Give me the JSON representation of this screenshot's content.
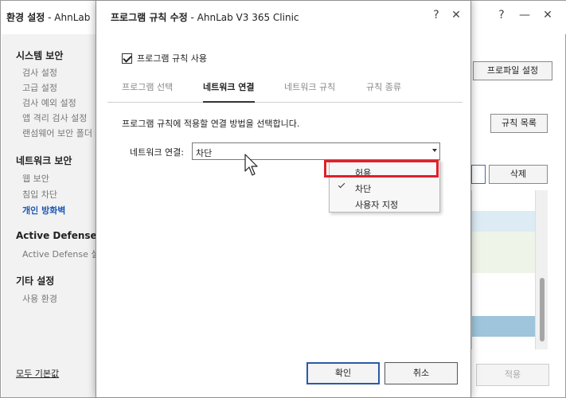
{
  "background": {
    "title_bold": "환경 설정",
    "title_light": " - AhnLab",
    "controls": {
      "help": "?",
      "minimize": "—",
      "close": "✕"
    },
    "sidebar": {
      "sections": [
        {
          "heading": "시스템 보안",
          "items": [
            "검사 설정",
            "고급 설정",
            "검사 예외 설정",
            "앱 격리 검사 설정",
            "랜섬웨어 보안 폴더"
          ]
        },
        {
          "heading": "네트워크 보안",
          "items": [
            "웹 보안",
            "침입 차단",
            "개인 방화벽"
          ]
        },
        {
          "heading": "Active Defense",
          "items": [
            "Active Defense 설정"
          ]
        },
        {
          "heading": "기타 설정",
          "items": [
            "사용 환경"
          ]
        }
      ],
      "active_item": "개인 방화벽",
      "reset_link": "모두 기본값"
    },
    "buttons": {
      "profile_settings": "프로파일 설정",
      "rule_list": "규칙 목록",
      "delete": "삭제",
      "apply": "적용"
    },
    "colors": {
      "row_selected": "#9ec5dc",
      "row_light": "#dcebf4",
      "row_alt": "#eef4e8"
    }
  },
  "dialog": {
    "title_bold": "프로그램 규칙 수정",
    "title_light": " - AhnLab V3 365 Clinic",
    "help": "?",
    "close": "✕",
    "checkbox_label": "프로그램 규칙 사용",
    "checkbox_checked": true,
    "tabs": [
      "프로그램 선택",
      "네트워크 연결",
      "네트워크 규칙",
      "규칙 종류"
    ],
    "active_tab": "네트워크 연결",
    "description": "프로그램 규칙에 적용할 연결 방법을 선택합니다.",
    "field_label": "네트워크 연결:",
    "select_value": "차단",
    "dropdown_options": [
      "허용",
      "차단",
      "사용자 지정"
    ],
    "selected_option": "차단",
    "highlighted_option": "허용",
    "ok_button": "확인",
    "cancel_button": "취소",
    "colors": {
      "highlight": "#e0202a",
      "primary_border": "#2b5aa8"
    }
  }
}
